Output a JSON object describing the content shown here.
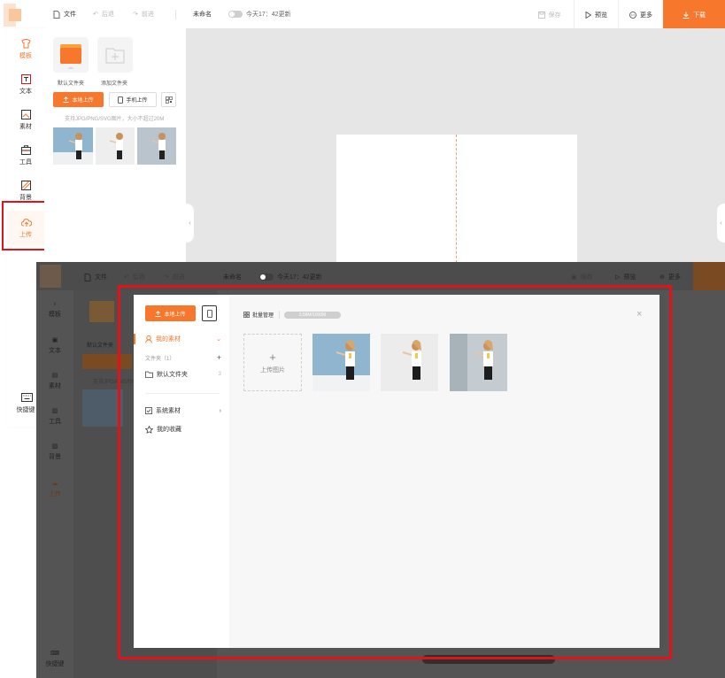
{
  "toolbar": {
    "file_label": "文件",
    "undo_label": "后退",
    "redo_label": "前进",
    "doc_title": "未命名",
    "autosave_text": "今天17：42更新",
    "save_label": "保存",
    "preview_label": "预览",
    "more_label": "更多",
    "download_label": "下载"
  },
  "sidebar": {
    "items": [
      {
        "label": "模板",
        "icon": "template-icon"
      },
      {
        "label": "文本",
        "icon": "text-icon"
      },
      {
        "label": "素材",
        "icon": "material-icon"
      },
      {
        "label": "工具",
        "icon": "toolbox-icon"
      },
      {
        "label": "背景",
        "icon": "background-icon"
      },
      {
        "label": "上传",
        "icon": "upload-cloud-icon"
      }
    ],
    "shortcut_label": "快捷键"
  },
  "upload_panel": {
    "default_folder": "默认文件夹",
    "add_folder": "添加文件夹",
    "local_upload": "本地上传",
    "phone_upload": "手机上传",
    "support_hint": "支持JPG/PNG/SVG图片，大小不超过20M"
  },
  "overlay": {
    "storage_hint": "支持JPG/PNG/SVG"
  },
  "modal": {
    "local_upload": "本地上传",
    "my_materials": "我的素材",
    "folder_count": "文件夹（1）",
    "default_folder": "默认文件夹",
    "default_folder_count": "3",
    "system_materials": "系统素材",
    "my_favorites": "我的收藏",
    "batch_manage": "批量管理",
    "storage_usage": "3.58M/1000M",
    "upload_image": "上传图片"
  },
  "colors": {
    "accent": "#f7772c",
    "highlight": "#e0131b"
  }
}
